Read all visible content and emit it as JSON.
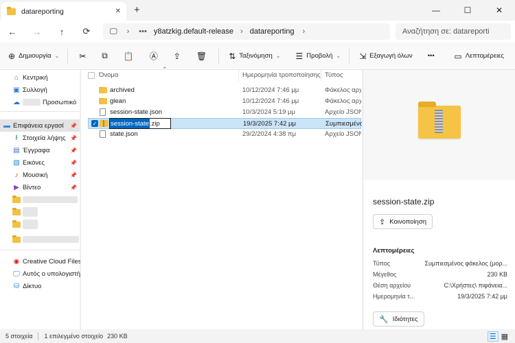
{
  "window": {
    "tab_title": "datareporting",
    "close_tab": "✕",
    "new_tab": "+",
    "minimize": "—",
    "maximize": "☐",
    "close": "✕"
  },
  "nav": {
    "back": "←",
    "forward": "→",
    "up": "↑",
    "refresh": "⟳",
    "breadcrumb": [
      "y8atzkig.default-release",
      "datareporting"
    ],
    "search_placeholder": "Αναζήτηση σε: datareporti"
  },
  "toolbar": {
    "new_label": "Δημιουργία",
    "sort_label": "Ταξινόμηση",
    "view_label": "Προβολή",
    "extract_label": "Εξαγωγή όλων",
    "more_label": "•••",
    "details_label": "Λεπτομέρειες"
  },
  "sidebar": {
    "items": [
      {
        "label": "Κεντρική",
        "icon": "home-icon"
      },
      {
        "label": "Συλλογή",
        "icon": "gallery-icon"
      },
      {
        "label": "Προσωπικό",
        "icon": "cloud-icon"
      },
      {
        "label": "Επιφάνεια εργασί",
        "icon": "desktop-icon"
      },
      {
        "label": "Στοιχεία λήψης",
        "icon": "download-icon"
      },
      {
        "label": "Έγγραφα",
        "icon": "documents-icon"
      },
      {
        "label": "Εικόνες",
        "icon": "pictures-icon"
      },
      {
        "label": "Μουσική",
        "icon": "music-icon"
      },
      {
        "label": "Βίντεο",
        "icon": "video-icon"
      },
      {
        "label": "Creative Cloud Files F",
        "icon": "creative-cloud-icon"
      },
      {
        "label": "Αυτός ο υπολογιστή",
        "icon": "computer-icon"
      },
      {
        "label": "Δίκτυο",
        "icon": "network-icon"
      }
    ]
  },
  "filelist": {
    "columns": [
      "Όνομα",
      "Ημερομηνία τροποποίησης",
      "Τύπος"
    ],
    "rows": [
      {
        "name": "archived",
        "date": "10/12/2024 7:46 μμ",
        "type": "Φάκελος αρχ"
      },
      {
        "name": "glean",
        "date": "10/12/2024 7:46 μμ",
        "type": "Φάκελος αρχ"
      },
      {
        "name": "session-state.json",
        "date": "10/3/2024 5:19 μμ",
        "type": "Αρχείο JSON"
      },
      {
        "name_selected": "session-state",
        "name_ext": ".zip",
        "date": "19/3/2025 7:42 μμ",
        "type": "Συμπιεσμένο"
      },
      {
        "name": "state.json",
        "date": "29/2/2024 4:38 πμ",
        "type": "Αρχείο JSON"
      }
    ]
  },
  "details": {
    "filename": "session-state.zip",
    "share_label": "Κοινοποίηση",
    "section_title": "Λεπτομέρειες",
    "props": [
      {
        "key": "Τύπος",
        "value": "Συμπιεσμένος φάκελος (μορ..."
      },
      {
        "key": "Μέγεθος",
        "value": "230 KB"
      },
      {
        "key": "Θέση αρχείου",
        "value": "C:\\Χρήστες\\       πιφάνεια..."
      },
      {
        "key": "Ημερομηνία τ...",
        "value": "19/3/2025 7:42 μμ"
      }
    ],
    "properties_label": "Ιδιότητες"
  },
  "status": {
    "count": "5 στοιχεία",
    "selected": "1 επιλεγμένο στοιχείο",
    "size": "230 KB"
  }
}
